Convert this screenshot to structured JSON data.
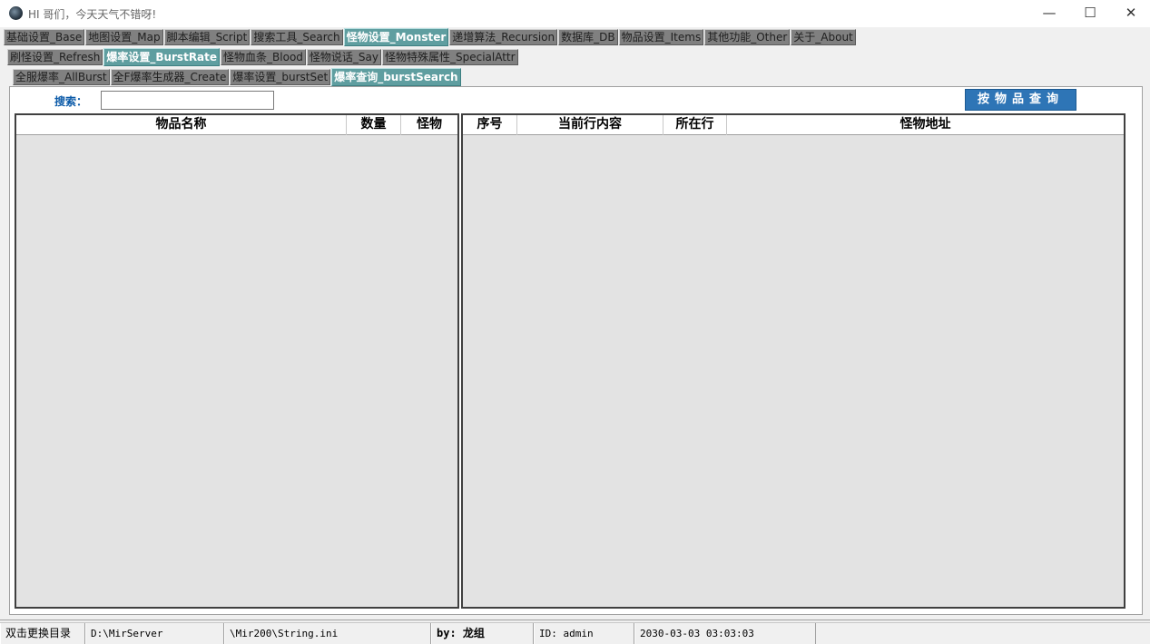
{
  "window": {
    "title": "HI 哥们，今天天气不错呀!",
    "minimize": "—",
    "maximize": "☐",
    "close": "✕"
  },
  "tabs_main": [
    {
      "label": "基础设置_Base",
      "active": false
    },
    {
      "label": "地图设置_Map",
      "active": false
    },
    {
      "label": "脚本编辑_Script",
      "active": false
    },
    {
      "label": "搜索工具_Search",
      "active": false
    },
    {
      "label": "怪物设置_Monster",
      "active": true
    },
    {
      "label": "递增算法_Recursion",
      "active": false
    },
    {
      "label": "数据库_DB",
      "active": false
    },
    {
      "label": "物品设置_Items",
      "active": false
    },
    {
      "label": "其他功能_Other",
      "active": false
    },
    {
      "label": "关于_About",
      "active": false
    }
  ],
  "tabs_monster": [
    {
      "label": "刷怪设置_Refresh",
      "active": false
    },
    {
      "label": "爆率设置_BurstRate",
      "active": true
    },
    {
      "label": "怪物血条_Blood",
      "active": false
    },
    {
      "label": "怪物说话_Say",
      "active": false
    },
    {
      "label": "怪物特殊属性_SpecialAttr",
      "active": false
    }
  ],
  "tabs_burst": [
    {
      "label": "全服爆率_AllBurst",
      "active": false
    },
    {
      "label": "全F爆率生成器_Create",
      "active": false
    },
    {
      "label": "爆率设置_burstSet",
      "active": false
    },
    {
      "label": "爆率查询_burstSearch",
      "active": true
    }
  ],
  "search": {
    "label": "搜索：",
    "value": "",
    "query_button": "按物品查询"
  },
  "left_grid": {
    "columns": [
      "物品名称",
      "数量",
      "怪物"
    ]
  },
  "right_grid": {
    "columns": [
      "序号",
      "当前行内容",
      "所在行",
      "怪物地址"
    ]
  },
  "statusbar": {
    "dir_hint": "双击更换目录",
    "server_path": "D:\\MirServer",
    "file_path": "\\Mir200\\String.ini",
    "by": "by: 龙组",
    "user": "ID: admin",
    "datetime": "2030-03-03 03:03:03"
  }
}
